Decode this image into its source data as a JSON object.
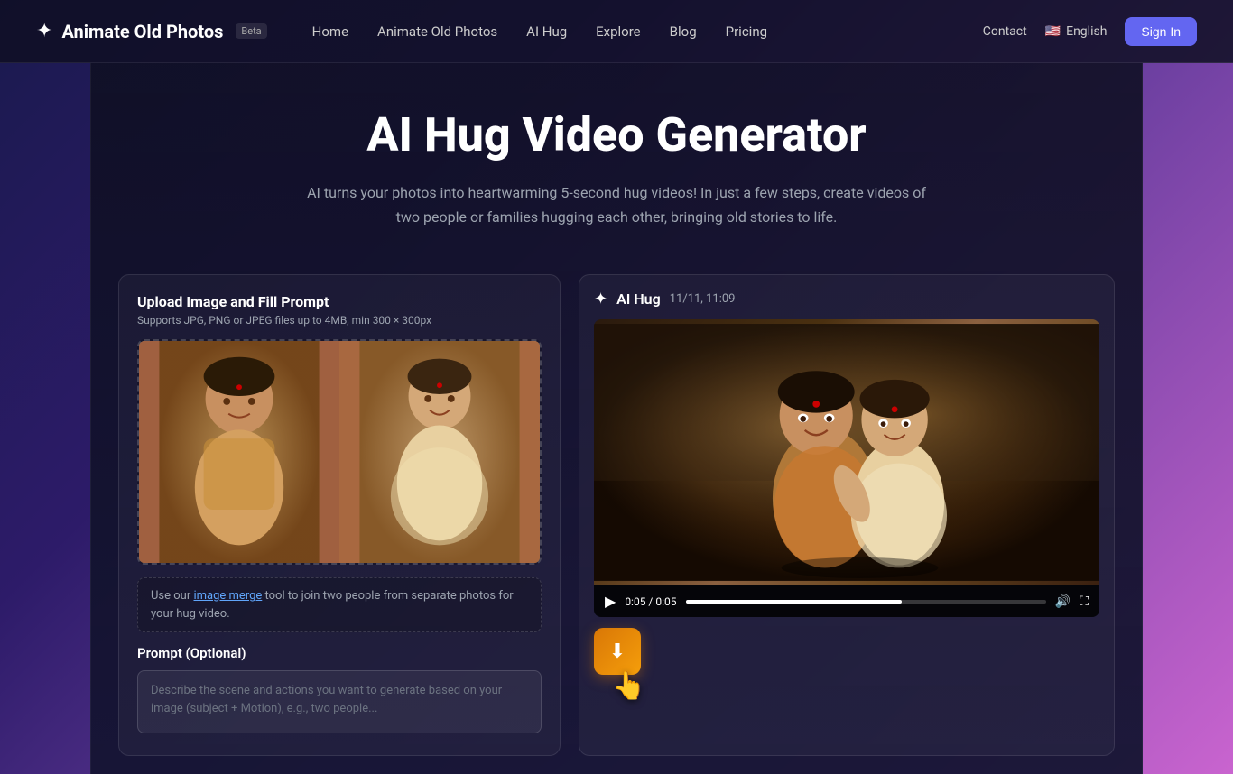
{
  "navbar": {
    "logo_icon": "✦",
    "logo_text": "Animate Old Photos",
    "beta_label": "Beta",
    "nav_links": [
      {
        "label": "Home",
        "id": "home"
      },
      {
        "label": "Animate Old Photos",
        "id": "animate"
      },
      {
        "label": "AI Hug",
        "id": "ai-hug"
      },
      {
        "label": "Explore",
        "id": "explore"
      },
      {
        "label": "Blog",
        "id": "blog"
      },
      {
        "label": "Pricing",
        "id": "pricing"
      }
    ],
    "contact_label": "Contact",
    "lang_label": "English",
    "sign_in_label": "Sign In"
  },
  "hero": {
    "title": "AI Hug Video Generator",
    "subtitle": "AI turns your photos into heartwarming 5-second hug videos! In just a few steps, create videos of two people or families hugging each other, bringing old stories to life."
  },
  "upload_panel": {
    "title": "Upload Image and Fill Prompt",
    "subtitle": "Supports JPG, PNG or JPEG files up to 4MB, min 300 × 300px",
    "merge_text_before": "Use our ",
    "merge_link": "image merge",
    "merge_text_after": " tool to join two people from separate photos for your hug video.",
    "prompt_label": "Prompt (Optional)",
    "prompt_placeholder": "Describe the scene and actions you want to generate based on your image (subject + Motion), e.g., two people..."
  },
  "video_panel": {
    "icon": "✦",
    "label": "AI Hug",
    "timestamp": "11/11, 11:09",
    "time_current": "0:05",
    "time_total": "0:05",
    "time_display": "0:05 / 0:05",
    "download_icon": "⬇"
  }
}
